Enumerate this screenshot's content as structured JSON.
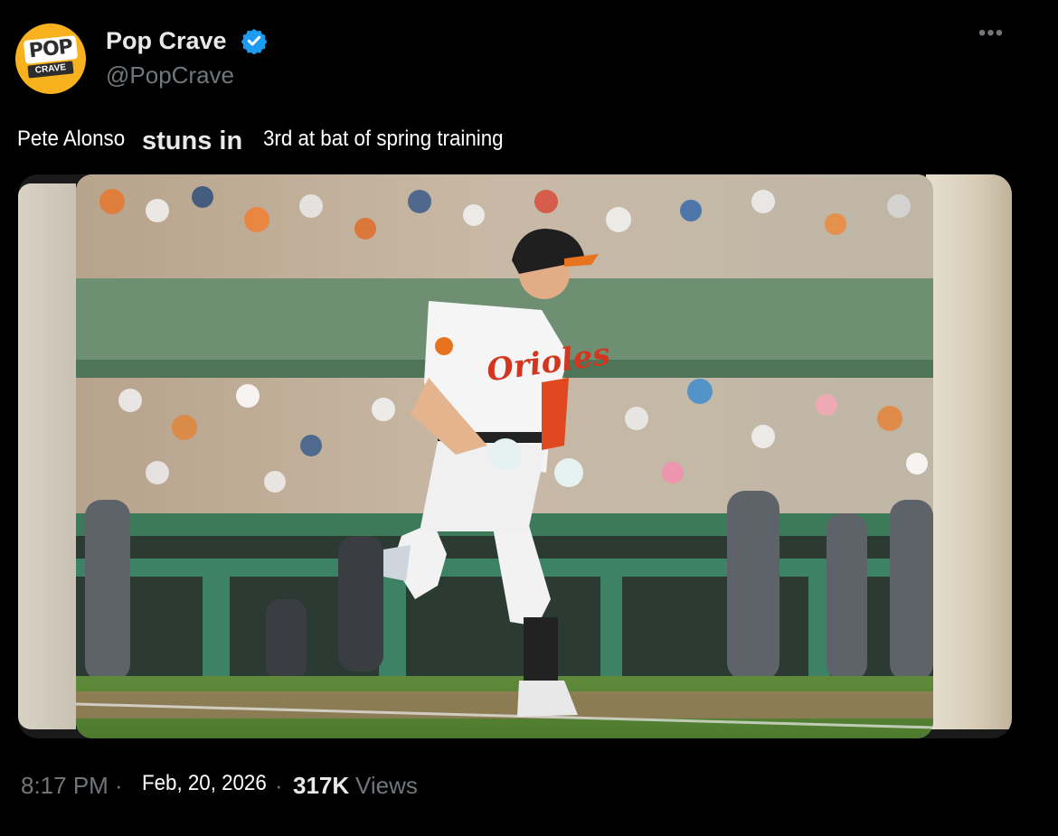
{
  "account": {
    "display_name": "Pop Crave",
    "handle": "@PopCrave",
    "verified_icon": "verified-badge-icon",
    "avatar_logo_top": "POP",
    "avatar_logo_bottom": "CRAVE",
    "more_label": "•••"
  },
  "tweet": {
    "segments": [
      "Pete Alonso",
      "stuns in",
      "3rd at bat of spring training"
    ]
  },
  "media": {
    "jersey_text": "Orioles"
  },
  "footer": {
    "time": "8:17 PM ·",
    "date": "Feb, 20, 2026",
    "separator": "·",
    "views_count": "317K",
    "views_label": "Views"
  },
  "colors": {
    "background": "#000000",
    "verified_blue": "#1d9bf0",
    "muted_text": "#71767b",
    "primary_text": "#e7e9ea"
  }
}
